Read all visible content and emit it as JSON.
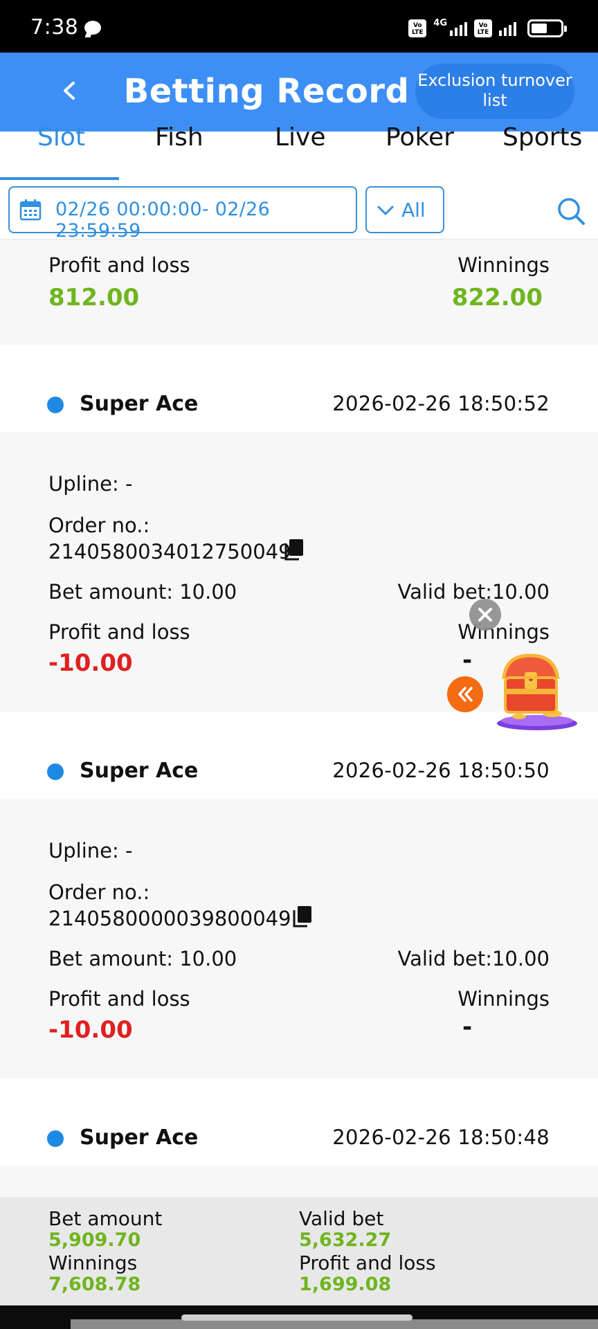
{
  "status_bar": {
    "time": "7:38",
    "network": "4G"
  },
  "header": {
    "title": "Betting Record",
    "exclusion_button": "Exclusion turnover list"
  },
  "tabs": [
    {
      "label": "Slot",
      "active": true
    },
    {
      "label": "Fish",
      "active": false
    },
    {
      "label": "Live",
      "active": false
    },
    {
      "label": "Poker",
      "active": false
    },
    {
      "label": "Sports",
      "active": false
    }
  ],
  "filter": {
    "date_range": "02/26 00:00:00- 02/26 23:59:59",
    "type_selected": "All"
  },
  "summary_partial": {
    "pl_label": "Profit and loss",
    "pl_value": "812.00",
    "win_label": "Winnings",
    "win_value": "822.00"
  },
  "labels": {
    "upline": "Upline: -",
    "order_no": "Order no.:",
    "profit_loss": "Profit and loss",
    "winnings": "Winnings"
  },
  "records": [
    {
      "game": "Super Ace",
      "time": "2026-02-26 18:50:52",
      "order_no": "2140580034012750049",
      "bet_amount": "Bet amount: 10.00",
      "valid_bet": "Valid bet:10.00",
      "profit_loss": "-10.00",
      "winnings": "-"
    },
    {
      "game": "Super Ace",
      "time": "2026-02-26 18:50:50",
      "order_no": "2140580000039800049",
      "bet_amount": "Bet amount: 10.00",
      "valid_bet": "Valid bet:10.00",
      "profit_loss": "-10.00",
      "winnings": "-"
    },
    {
      "game": "Super Ace",
      "time": "2026-02-26 18:50:48"
    }
  ],
  "totals": {
    "bet_amount_label": "Bet amount",
    "bet_amount": "5,909.70",
    "valid_bet_label": "Valid bet",
    "valid_bet": "5,632.27",
    "winnings_label": "Winnings",
    "winnings": "7,608.78",
    "profit_loss_label": "Profit and loss",
    "profit_loss": "1,699.08"
  },
  "colors": {
    "header_blue": "#3d8ff5",
    "accent_blue": "#2f8fe0",
    "positive_green": "#6fb51f",
    "negative_red": "#e02020"
  }
}
